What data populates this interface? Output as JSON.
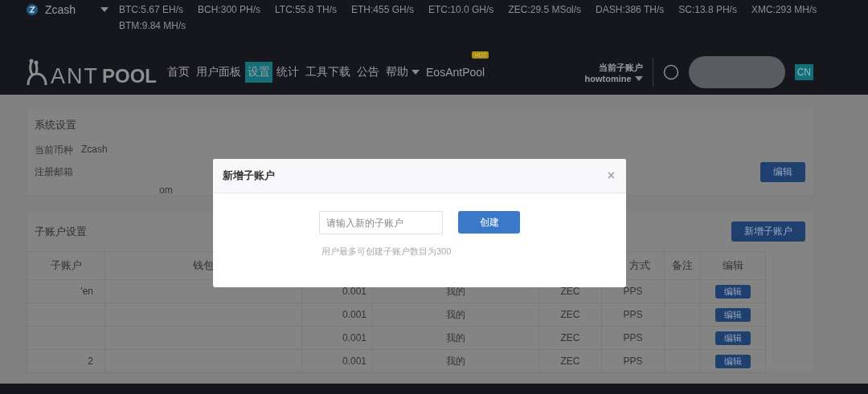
{
  "coin_selector": {
    "label": "Zcash"
  },
  "hashrates": [
    "BTC:5.67 EH/s",
    "BCH:300 PH/s",
    "LTC:55.8 TH/s",
    "ETH:455 GH/s",
    "ETC:10.0 GH/s",
    "ZEC:29.5 MSol/s",
    "DASH:386 TH/s",
    "SC:13.8 PH/s",
    "XMC:293 MH/s",
    "BTM:9.84 MH/s"
  ],
  "logo": {
    "thin": "ANT",
    "bold": "POOL"
  },
  "nav": [
    {
      "label": "首页",
      "selected": false
    },
    {
      "label": "用户面板",
      "selected": false
    },
    {
      "label": "设置",
      "selected": true
    },
    {
      "label": "统计",
      "selected": false
    },
    {
      "label": "工具下载",
      "selected": false
    },
    {
      "label": "公告",
      "selected": false
    },
    {
      "label": "帮助",
      "selected": false,
      "dropdown": true
    },
    {
      "label": "EosAntPool",
      "selected": false,
      "badge": "HOT"
    }
  ],
  "account": {
    "label": "当前子账户",
    "name": "howtomine"
  },
  "language": "CN",
  "system_settings": {
    "title": "系统设置",
    "currency_label": "当前币种",
    "currency": "Zcash",
    "email_label": "注册邮箱",
    "email_fragment": "om",
    "edit_button": "编辑"
  },
  "subaccounts": {
    "title": "子账户设置",
    "add_button": "新增子账户",
    "columns": [
      {
        "label": "子账户"
      },
      {
        "label": "钱包"
      },
      {},
      {},
      {},
      {
        "label": "方式"
      },
      {
        "label": "备注"
      },
      {
        "label": "编辑"
      }
    ],
    "rows": [
      {
        "account": "'en",
        "minimum": "0.001",
        "owner": "我的",
        "coin": "ZEC",
        "method": "PPS",
        "action": "编辑"
      },
      {
        "minimum": "0.001",
        "owner": "我的",
        "coin": "ZEC",
        "method": "PPS",
        "action": "编辑"
      },
      {
        "minimum": "0.001",
        "owner": "我的",
        "coin": "ZEC",
        "method": "PPS",
        "action": "编辑"
      },
      {
        "account": "2",
        "minimum": "0.001",
        "owner": "我的",
        "coin": "ZEC",
        "method": "PPS",
        "action": "编辑"
      }
    ]
  },
  "modal": {
    "title": "新增子账户",
    "close": "×",
    "input": {
      "placeholder": "请输入新的子账户"
    },
    "submit": "创建",
    "hint": "用户最多可创建子账户数目为300"
  }
}
